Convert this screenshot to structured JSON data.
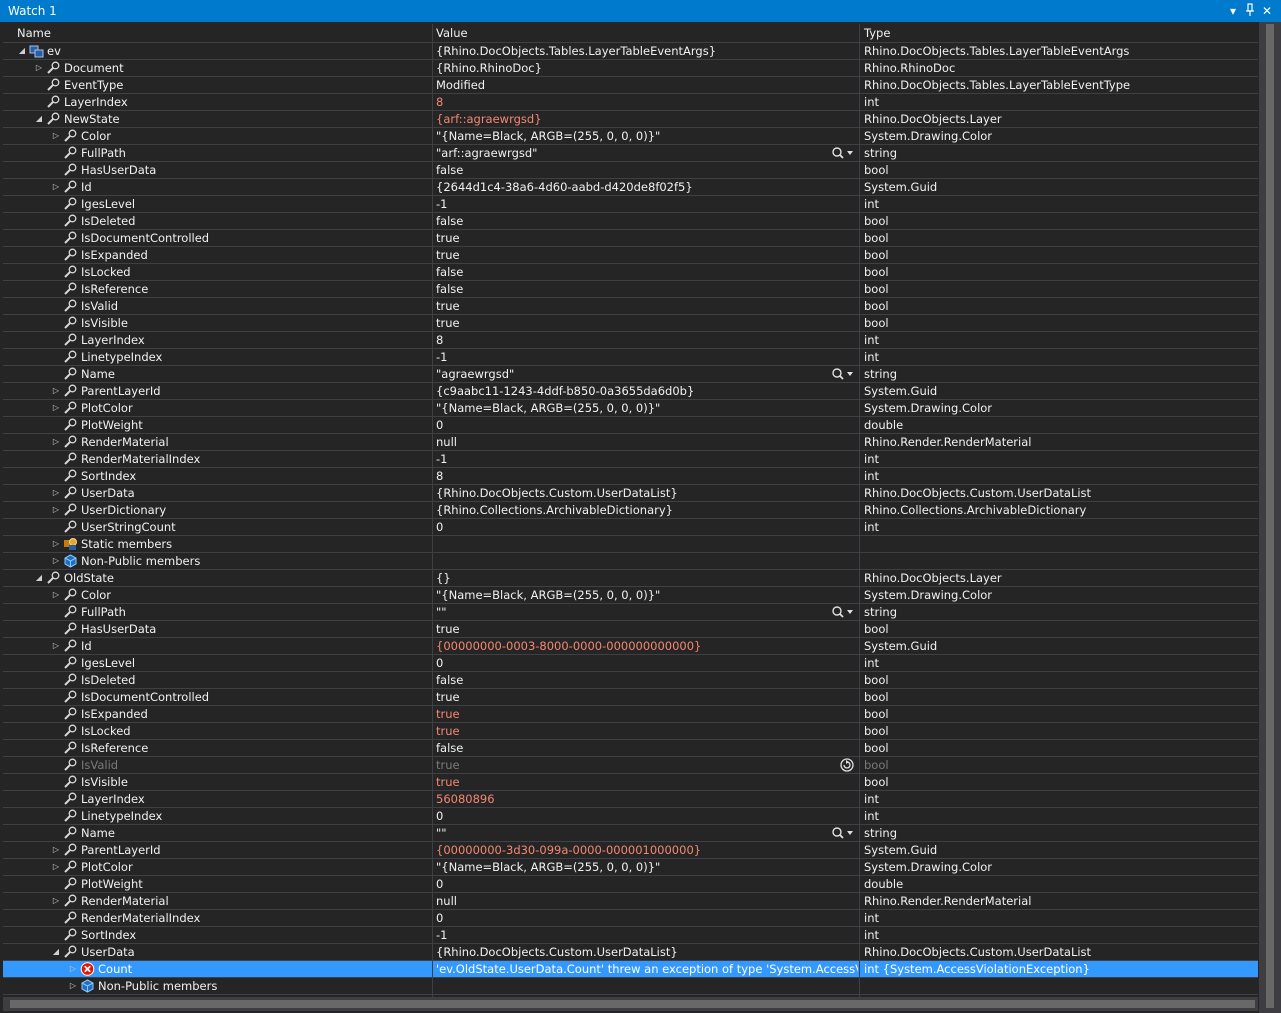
{
  "window": {
    "title": "Watch 1"
  },
  "columns": {
    "name": "Name",
    "value": "Value",
    "type": "Type"
  },
  "rows": [
    {
      "indent": 0,
      "exp": "open",
      "icon": "object",
      "name": "ev",
      "value": "{Rhino.DocObjects.Tables.LayerTableEventArgs}",
      "type": "Rhino.DocObjects.Tables.LayerTableEventArgs",
      "vstate": "normal"
    },
    {
      "indent": 1,
      "exp": "closed",
      "icon": "wrench",
      "name": "Document",
      "value": "{Rhino.RhinoDoc}",
      "type": "Rhino.RhinoDoc",
      "vstate": "normal"
    },
    {
      "indent": 1,
      "exp": "none",
      "icon": "wrench",
      "name": "EventType",
      "value": "Modified",
      "type": "Rhino.DocObjects.Tables.LayerTableEventType",
      "vstate": "normal"
    },
    {
      "indent": 1,
      "exp": "none",
      "icon": "wrench",
      "name": "LayerIndex",
      "value": "8",
      "type": "int",
      "vstate": "changed"
    },
    {
      "indent": 1,
      "exp": "open",
      "icon": "wrench",
      "name": "NewState",
      "value": "{arf::agraewrgsd}",
      "type": "Rhino.DocObjects.Layer",
      "vstate": "changed"
    },
    {
      "indent": 2,
      "exp": "closed",
      "icon": "wrench",
      "name": "Color",
      "value": "\"{Name=Black, ARGB=(255, 0, 0, 0)}\"",
      "type": "System.Drawing.Color",
      "vstate": "normal"
    },
    {
      "indent": 2,
      "exp": "none",
      "icon": "wrench",
      "name": "FullPath",
      "value": "\"arf::agraewrgsd\"",
      "type": "string",
      "vstate": "normal",
      "viz": true
    },
    {
      "indent": 2,
      "exp": "none",
      "icon": "wrench",
      "name": "HasUserData",
      "value": "false",
      "type": "bool",
      "vstate": "normal"
    },
    {
      "indent": 2,
      "exp": "closed",
      "icon": "wrench",
      "name": "Id",
      "value": "{2644d1c4-38a6-4d60-aabd-d420de8f02f5}",
      "type": "System.Guid",
      "vstate": "normal"
    },
    {
      "indent": 2,
      "exp": "none",
      "icon": "wrench",
      "name": "IgesLevel",
      "value": "-1",
      "type": "int",
      "vstate": "normal"
    },
    {
      "indent": 2,
      "exp": "none",
      "icon": "wrench",
      "name": "IsDeleted",
      "value": "false",
      "type": "bool",
      "vstate": "normal"
    },
    {
      "indent": 2,
      "exp": "none",
      "icon": "wrench",
      "name": "IsDocumentControlled",
      "value": "true",
      "type": "bool",
      "vstate": "normal"
    },
    {
      "indent": 2,
      "exp": "none",
      "icon": "wrench",
      "name": "IsExpanded",
      "value": "true",
      "type": "bool",
      "vstate": "normal"
    },
    {
      "indent": 2,
      "exp": "none",
      "icon": "wrench",
      "name": "IsLocked",
      "value": "false",
      "type": "bool",
      "vstate": "normal"
    },
    {
      "indent": 2,
      "exp": "none",
      "icon": "wrench",
      "name": "IsReference",
      "value": "false",
      "type": "bool",
      "vstate": "normal"
    },
    {
      "indent": 2,
      "exp": "none",
      "icon": "wrench",
      "name": "IsValid",
      "value": "true",
      "type": "bool",
      "vstate": "normal"
    },
    {
      "indent": 2,
      "exp": "none",
      "icon": "wrench",
      "name": "IsVisible",
      "value": "true",
      "type": "bool",
      "vstate": "normal"
    },
    {
      "indent": 2,
      "exp": "none",
      "icon": "wrench",
      "name": "LayerIndex",
      "value": "8",
      "type": "int",
      "vstate": "normal"
    },
    {
      "indent": 2,
      "exp": "none",
      "icon": "wrench",
      "name": "LinetypeIndex",
      "value": "-1",
      "type": "int",
      "vstate": "normal"
    },
    {
      "indent": 2,
      "exp": "none",
      "icon": "wrench",
      "name": "Name",
      "value": "\"agraewrgsd\"",
      "type": "string",
      "vstate": "normal",
      "viz": true
    },
    {
      "indent": 2,
      "exp": "closed",
      "icon": "wrench",
      "name": "ParentLayerId",
      "value": "{c9aabc11-1243-4ddf-b850-0a3655da6d0b}",
      "type": "System.Guid",
      "vstate": "normal"
    },
    {
      "indent": 2,
      "exp": "closed",
      "icon": "wrench",
      "name": "PlotColor",
      "value": "\"{Name=Black, ARGB=(255, 0, 0, 0)}\"",
      "type": "System.Drawing.Color",
      "vstate": "normal"
    },
    {
      "indent": 2,
      "exp": "none",
      "icon": "wrench",
      "name": "PlotWeight",
      "value": "0",
      "type": "double",
      "vstate": "normal"
    },
    {
      "indent": 2,
      "exp": "closed",
      "icon": "wrench",
      "name": "RenderMaterial",
      "value": "null",
      "type": "Rhino.Render.RenderMaterial",
      "vstate": "normal"
    },
    {
      "indent": 2,
      "exp": "none",
      "icon": "wrench",
      "name": "RenderMaterialIndex",
      "value": "-1",
      "type": "int",
      "vstate": "normal"
    },
    {
      "indent": 2,
      "exp": "none",
      "icon": "wrench",
      "name": "SortIndex",
      "value": "8",
      "type": "int",
      "vstate": "normal"
    },
    {
      "indent": 2,
      "exp": "closed",
      "icon": "wrench",
      "name": "UserData",
      "value": "{Rhino.DocObjects.Custom.UserDataList}",
      "type": "Rhino.DocObjects.Custom.UserDataList",
      "vstate": "normal"
    },
    {
      "indent": 2,
      "exp": "closed",
      "icon": "wrench",
      "name": "UserDictionary",
      "value": "{Rhino.Collections.ArchivableDictionary}",
      "type": "Rhino.Collections.ArchivableDictionary",
      "vstate": "normal"
    },
    {
      "indent": 2,
      "exp": "none",
      "icon": "wrench",
      "name": "UserStringCount",
      "value": "0",
      "type": "int",
      "vstate": "normal"
    },
    {
      "indent": 2,
      "exp": "closed",
      "icon": "static",
      "name": "Static members",
      "value": "",
      "type": "",
      "vstate": "normal"
    },
    {
      "indent": 2,
      "exp": "closed",
      "icon": "cube",
      "name": "Non-Public members",
      "value": "",
      "type": "",
      "vstate": "normal"
    },
    {
      "indent": 1,
      "exp": "open",
      "icon": "wrench",
      "name": "OldState",
      "value": "{}",
      "type": "Rhino.DocObjects.Layer",
      "vstate": "normal"
    },
    {
      "indent": 2,
      "exp": "closed",
      "icon": "wrench",
      "name": "Color",
      "value": "\"{Name=Black, ARGB=(255, 0, 0, 0)}\"",
      "type": "System.Drawing.Color",
      "vstate": "normal"
    },
    {
      "indent": 2,
      "exp": "none",
      "icon": "wrench",
      "name": "FullPath",
      "value": "\"\"",
      "type": "string",
      "vstate": "normal",
      "viz": true
    },
    {
      "indent": 2,
      "exp": "none",
      "icon": "wrench",
      "name": "HasUserData",
      "value": "true",
      "type": "bool",
      "vstate": "normal"
    },
    {
      "indent": 2,
      "exp": "closed",
      "icon": "wrench",
      "name": "Id",
      "value": "{00000000-0003-8000-0000-000000000000}",
      "type": "System.Guid",
      "vstate": "changed"
    },
    {
      "indent": 2,
      "exp": "none",
      "icon": "wrench",
      "name": "IgesLevel",
      "value": "0",
      "type": "int",
      "vstate": "normal"
    },
    {
      "indent": 2,
      "exp": "none",
      "icon": "wrench",
      "name": "IsDeleted",
      "value": "false",
      "type": "bool",
      "vstate": "normal"
    },
    {
      "indent": 2,
      "exp": "none",
      "icon": "wrench",
      "name": "IsDocumentControlled",
      "value": "true",
      "type": "bool",
      "vstate": "normal"
    },
    {
      "indent": 2,
      "exp": "none",
      "icon": "wrench",
      "name": "IsExpanded",
      "value": "true",
      "type": "bool",
      "vstate": "changed"
    },
    {
      "indent": 2,
      "exp": "none",
      "icon": "wrench",
      "name": "IsLocked",
      "value": "true",
      "type": "bool",
      "vstate": "changed"
    },
    {
      "indent": 2,
      "exp": "none",
      "icon": "wrench",
      "name": "IsReference",
      "value": "false",
      "type": "bool",
      "vstate": "normal"
    },
    {
      "indent": 2,
      "exp": "none",
      "icon": "wrench",
      "name": "IsValid",
      "value": "true",
      "type": "bool",
      "vstate": "stale",
      "refresh": true
    },
    {
      "indent": 2,
      "exp": "none",
      "icon": "wrench",
      "name": "IsVisible",
      "value": "true",
      "type": "bool",
      "vstate": "changed"
    },
    {
      "indent": 2,
      "exp": "none",
      "icon": "wrench",
      "name": "LayerIndex",
      "value": "56080896",
      "type": "int",
      "vstate": "changed"
    },
    {
      "indent": 2,
      "exp": "none",
      "icon": "wrench",
      "name": "LinetypeIndex",
      "value": "0",
      "type": "int",
      "vstate": "normal"
    },
    {
      "indent": 2,
      "exp": "none",
      "icon": "wrench",
      "name": "Name",
      "value": "\"\"",
      "type": "string",
      "vstate": "normal",
      "viz": true
    },
    {
      "indent": 2,
      "exp": "closed",
      "icon": "wrench",
      "name": "ParentLayerId",
      "value": "{00000000-3d30-099a-0000-000001000000}",
      "type": "System.Guid",
      "vstate": "changed"
    },
    {
      "indent": 2,
      "exp": "closed",
      "icon": "wrench",
      "name": "PlotColor",
      "value": "\"{Name=Black, ARGB=(255, 0, 0, 0)}\"",
      "type": "System.Drawing.Color",
      "vstate": "normal"
    },
    {
      "indent": 2,
      "exp": "none",
      "icon": "wrench",
      "name": "PlotWeight",
      "value": "0",
      "type": "double",
      "vstate": "normal"
    },
    {
      "indent": 2,
      "exp": "closed",
      "icon": "wrench",
      "name": "RenderMaterial",
      "value": "null",
      "type": "Rhino.Render.RenderMaterial",
      "vstate": "normal"
    },
    {
      "indent": 2,
      "exp": "none",
      "icon": "wrench",
      "name": "RenderMaterialIndex",
      "value": "0",
      "type": "int",
      "vstate": "normal"
    },
    {
      "indent": 2,
      "exp": "none",
      "icon": "wrench",
      "name": "SortIndex",
      "value": "-1",
      "type": "int",
      "vstate": "normal"
    },
    {
      "indent": 2,
      "exp": "open",
      "icon": "wrench",
      "name": "UserData",
      "value": "{Rhino.DocObjects.Custom.UserDataList}",
      "type": "Rhino.DocObjects.Custom.UserDataList",
      "vstate": "normal"
    },
    {
      "indent": 3,
      "exp": "closed",
      "icon": "error",
      "name": "Count",
      "value": "'ev.OldState.UserData.Count' threw an exception of type 'System.AccessViolationException'",
      "type": "int {System.AccessViolationException}",
      "vstate": "normal",
      "selected": true
    },
    {
      "indent": 3,
      "exp": "closed",
      "icon": "cube",
      "name": "Non-Public members",
      "value": "",
      "type": "",
      "vstate": "normal"
    },
    {
      "indent": 0,
      "exp": "none",
      "icon": "none",
      "name": "",
      "value": "",
      "type": "",
      "vstate": "normal"
    }
  ]
}
